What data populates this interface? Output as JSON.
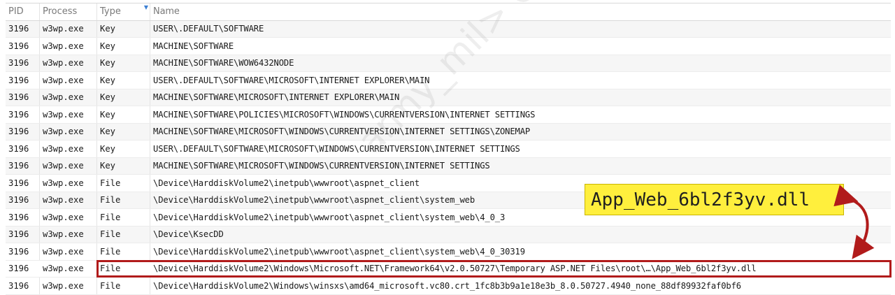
{
  "table": {
    "headers": {
      "pid": "PID",
      "process": "Process",
      "type": "Type",
      "name": "Name"
    },
    "rows": [
      {
        "pid": "3196",
        "process": "w3wp.exe",
        "type": "Key",
        "name": "USER\\.DEFAULT\\SOFTWARE"
      },
      {
        "pid": "3196",
        "process": "w3wp.exe",
        "type": "Key",
        "name": "MACHINE\\SOFTWARE"
      },
      {
        "pid": "3196",
        "process": "w3wp.exe",
        "type": "Key",
        "name": "MACHINE\\SOFTWARE\\WOW6432NODE"
      },
      {
        "pid": "3196",
        "process": "w3wp.exe",
        "type": "Key",
        "name": "USER\\.DEFAULT\\SOFTWARE\\MICROSOFT\\INTERNET EXPLORER\\MAIN"
      },
      {
        "pid": "3196",
        "process": "w3wp.exe",
        "type": "Key",
        "name": "MACHINE\\SOFTWARE\\MICROSOFT\\INTERNET EXPLORER\\MAIN"
      },
      {
        "pid": "3196",
        "process": "w3wp.exe",
        "type": "Key",
        "name": "MACHINE\\SOFTWARE\\POLICIES\\MICROSOFT\\WINDOWS\\CURRENTVERSION\\INTERNET SETTINGS"
      },
      {
        "pid": "3196",
        "process": "w3wp.exe",
        "type": "Key",
        "name": "MACHINE\\SOFTWARE\\MICROSOFT\\WINDOWS\\CURRENTVERSION\\INTERNET SETTINGS\\ZONEMAP"
      },
      {
        "pid": "3196",
        "process": "w3wp.exe",
        "type": "Key",
        "name": "USER\\.DEFAULT\\SOFTWARE\\MICROSOFT\\WINDOWS\\CURRENTVERSION\\INTERNET SETTINGS"
      },
      {
        "pid": "3196",
        "process": "w3wp.exe",
        "type": "Key",
        "name": "MACHINE\\SOFTWARE\\MICROSOFT\\WINDOWS\\CURRENTVERSION\\INTERNET SETTINGS"
      },
      {
        "pid": "3196",
        "process": "w3wp.exe",
        "type": "File",
        "name": "\\Device\\HarddiskVolume2\\inetpub\\wwwroot\\aspnet_client"
      },
      {
        "pid": "3196",
        "process": "w3wp.exe",
        "type": "File",
        "name": "\\Device\\HarddiskVolume2\\inetpub\\wwwroot\\aspnet_client\\system_web"
      },
      {
        "pid": "3196",
        "process": "w3wp.exe",
        "type": "File",
        "name": "\\Device\\HarddiskVolume2\\inetpub\\wwwroot\\aspnet_client\\system_web\\4_0_3"
      },
      {
        "pid": "3196",
        "process": "w3wp.exe",
        "type": "File",
        "name": "\\Device\\KsecDD"
      },
      {
        "pid": "3196",
        "process": "w3wp.exe",
        "type": "File",
        "name": "\\Device\\HarddiskVolume2\\inetpub\\wwwroot\\aspnet_client\\system_web\\4_0_30319"
      },
      {
        "pid": "3196",
        "process": "w3wp.exe",
        "type": "File",
        "name": "\\Device\\HarddiskVolume2\\Windows\\Microsoft.NET\\Framework64\\v2.0.50727\\Temporary ASP.NET Files\\root\\…\\App_Web_6bl2f3yv.dll"
      },
      {
        "pid": "3196",
        "process": "w3wp.exe",
        "type": "File",
        "name": "\\Device\\HarddiskVolume2\\Windows\\winsxs\\amd64_microsoft.vc80.crt_1fc8b3b9a1e18e3b_8.0.50727.4940_none_88df89932faf0bf6"
      }
    ]
  },
  "callout": {
    "text": "App_Web_6bl2f3yv.dll"
  },
  "watermark": {
    "text": "army_mil> October"
  },
  "colors": {
    "highlight": "#b11b1b",
    "callout_bg": "#ffef3d",
    "sort_indicator": "#3c7fd3"
  },
  "icons": {
    "sort": "sort-indicator-icon"
  }
}
